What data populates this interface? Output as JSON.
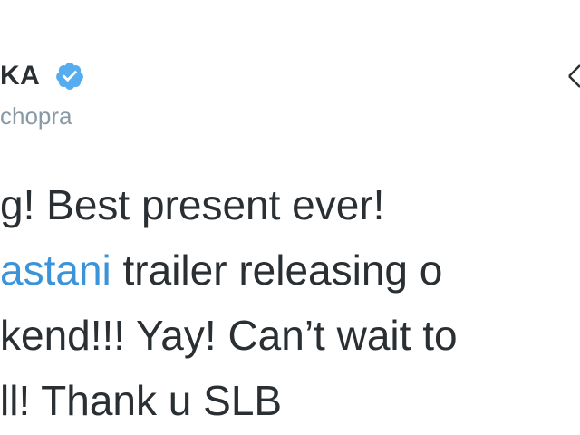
{
  "author": {
    "name": "KA",
    "handle": "chopra"
  },
  "icons": {
    "verified": "verified-badge-icon",
    "follow": "follow-icon"
  },
  "colors": {
    "text": "#292f33",
    "handle": "#8899a6",
    "link": "#3b94d9",
    "verified": "#55acee"
  },
  "tweet": {
    "line1": "g! Best present ever!",
    "line2_link": "astani",
    "line2_rest": " trailer releasing o",
    "line3": "kend!!! Yay! Can’t wait to",
    "line4": "ll! Thank u SLB"
  }
}
